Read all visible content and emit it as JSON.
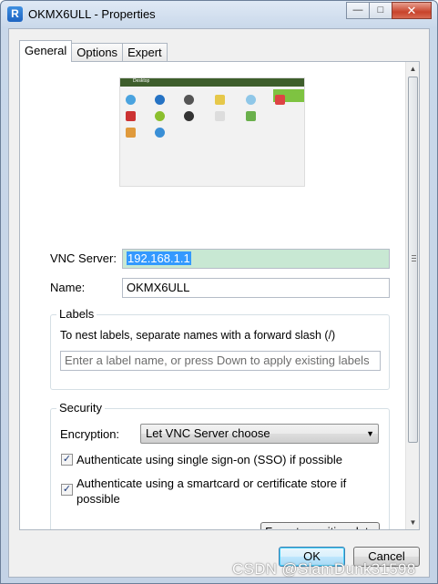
{
  "window": {
    "title": "OKMX6ULL - Properties",
    "app_icon_letter": "R"
  },
  "title_buttons": {
    "minimize": "—",
    "maximize": "□",
    "close": "✕"
  },
  "tabs": [
    {
      "label": "General",
      "active": true
    },
    {
      "label": "Options",
      "active": false
    },
    {
      "label": "Expert",
      "active": false
    }
  ],
  "preview": {
    "bar_title": "Desktop"
  },
  "vnc_server": {
    "label": "VNC Server:",
    "value": "192.168.1.1"
  },
  "name": {
    "label": "Name:",
    "value": "OKMX6ULL"
  },
  "labels_group": {
    "title": "Labels",
    "description": "To nest labels, separate names with a forward slash (/)",
    "placeholder": "Enter a label name, or press Down to apply existing labels"
  },
  "security_group": {
    "title": "Security",
    "encryption_label": "Encryption:",
    "encryption_value": "Let VNC Server choose",
    "sso_label": "Authenticate using single sign-on (SSO) if possible",
    "sso_checked": true,
    "smartcard_label_line1": "Authenticate using a smartcard or certificate store if",
    "smartcard_label_line2": "possible",
    "smartcard_checked": true,
    "forget_button": "Forget sensitive data"
  },
  "footer": {
    "ok_button": "OK",
    "cancel_button": "Cancel"
  },
  "watermark": "CSDN @SlamDunk31598"
}
